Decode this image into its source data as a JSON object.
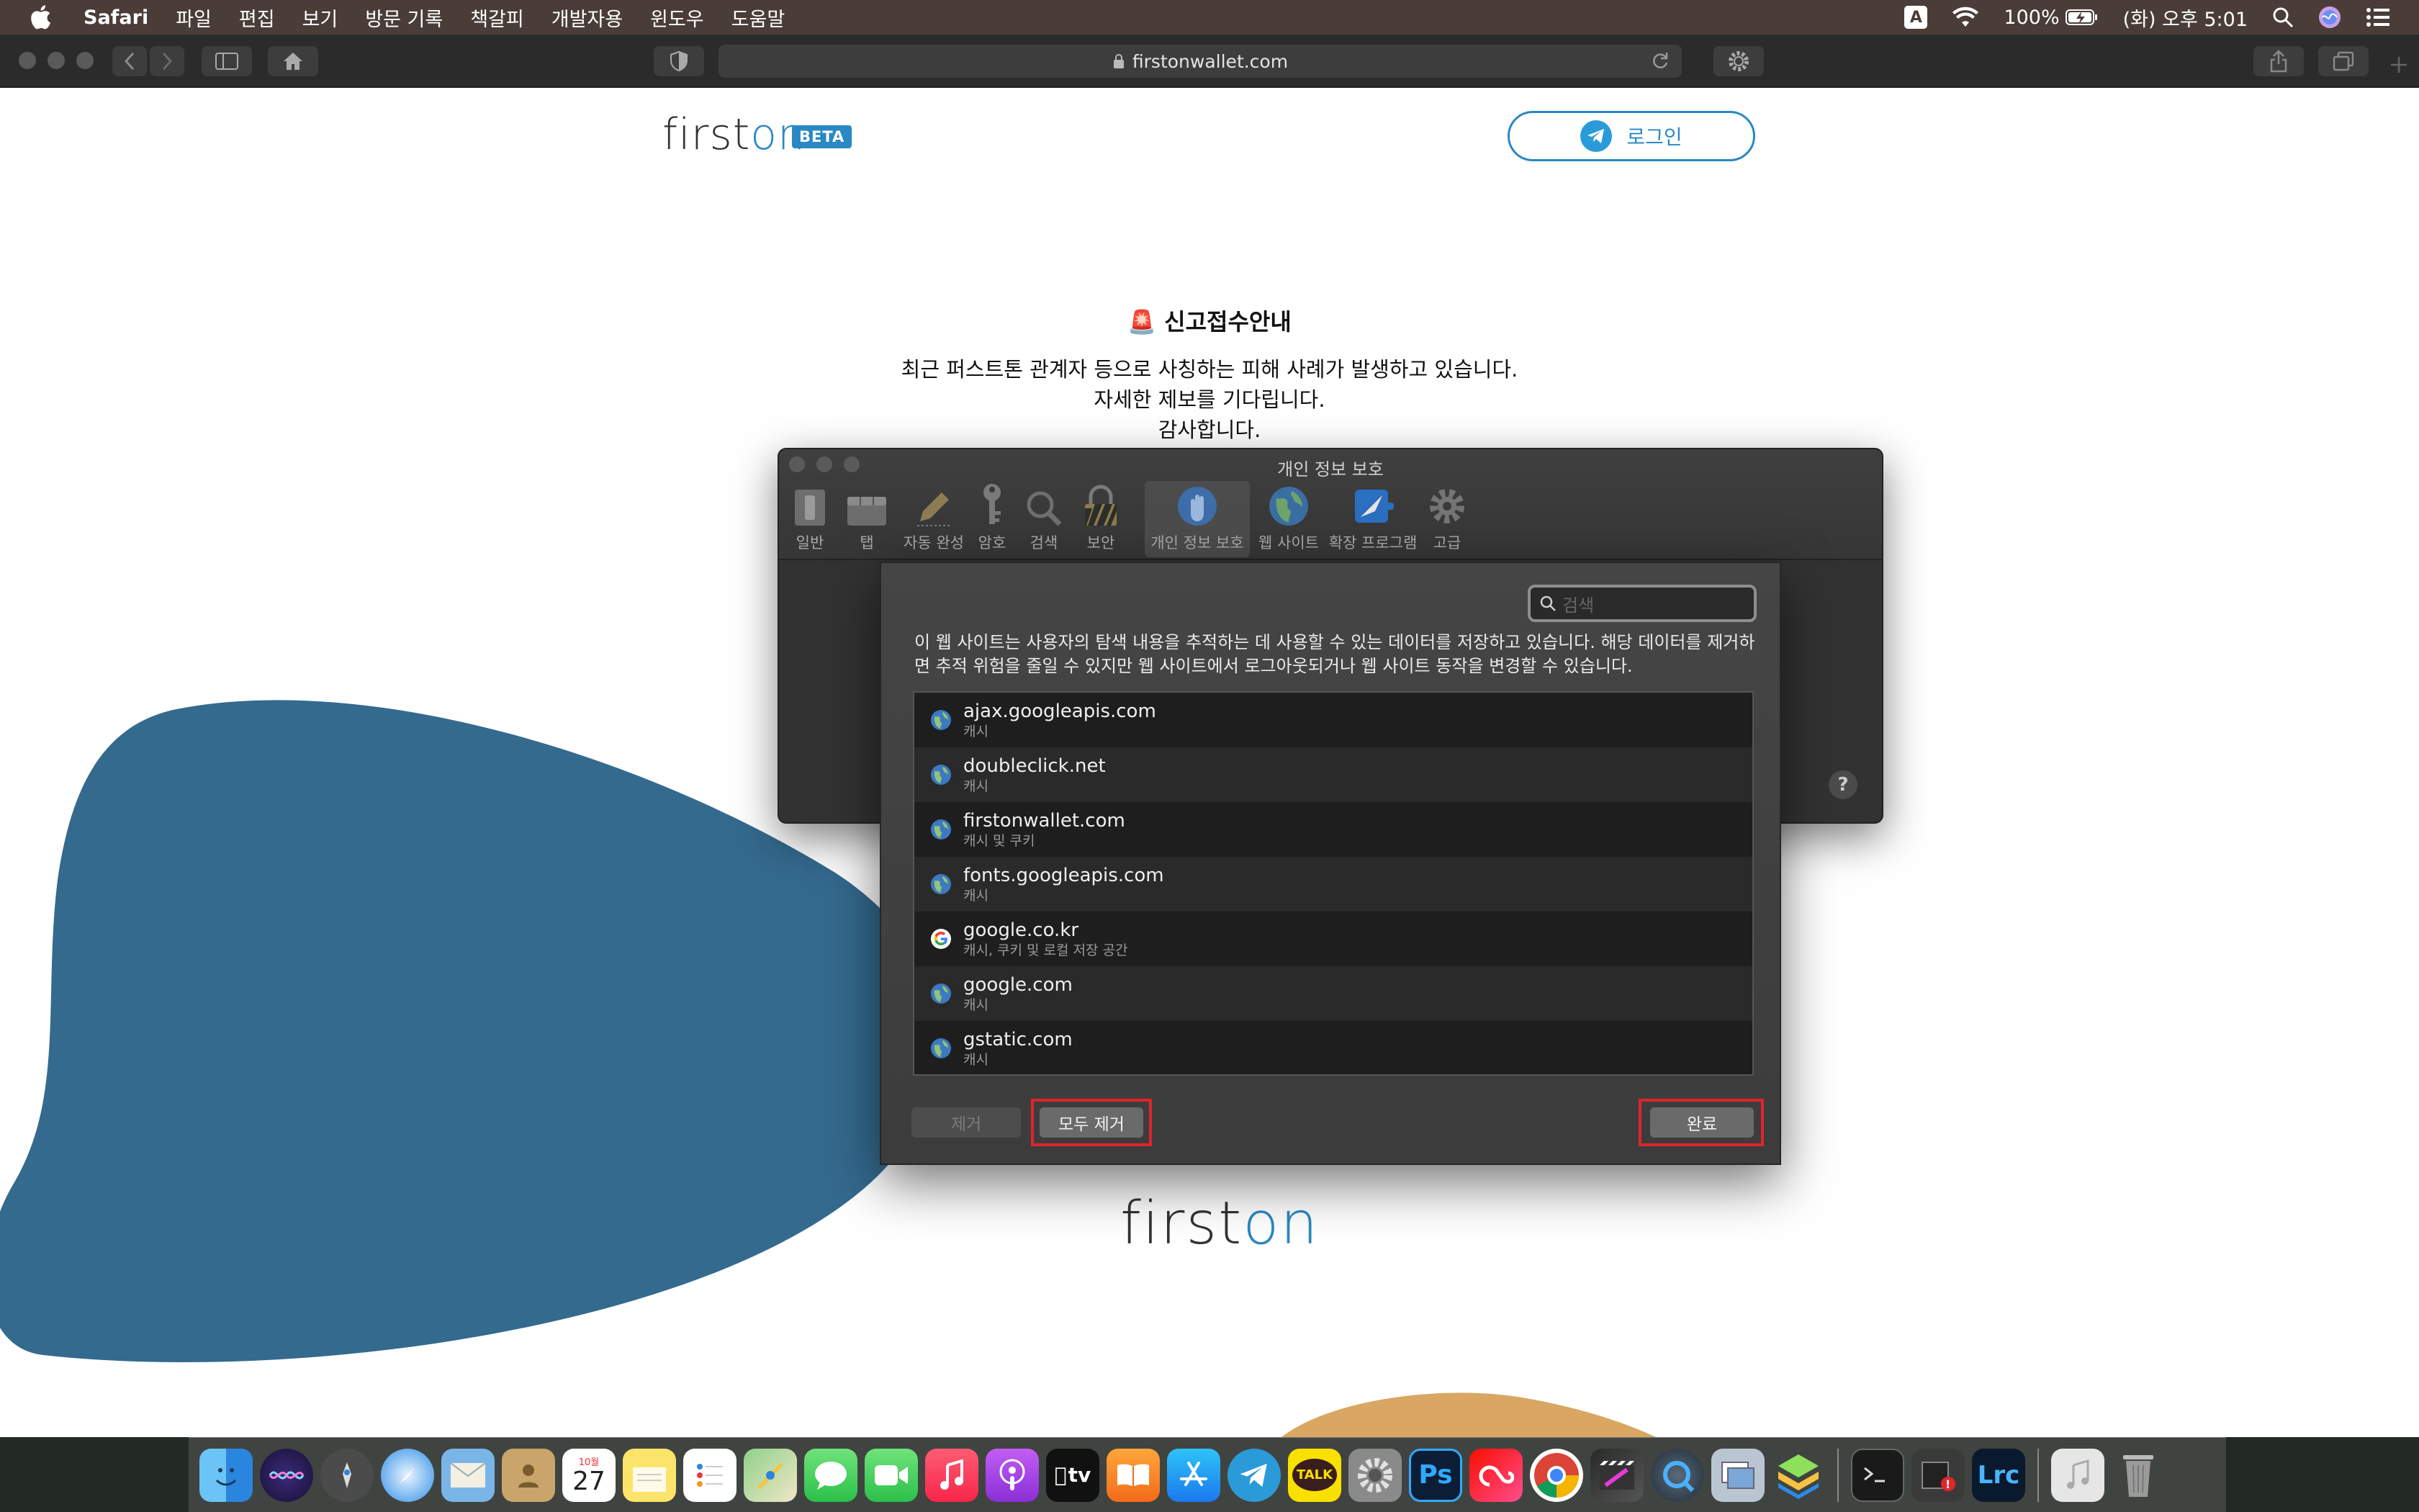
{
  "menubar": {
    "app": "Safari",
    "items": [
      "파일",
      "편집",
      "보기",
      "방문 기록",
      "책갈피",
      "개발자용",
      "윈도우",
      "도움말"
    ],
    "input_source": "A",
    "battery": "100%",
    "clock": "(화) 오후 5:01"
  },
  "toolbar": {
    "url": "firstonwallet.com"
  },
  "page": {
    "logo_first": "first",
    "logo_on": "on",
    "beta": "BETA",
    "login": "로그인",
    "notice_title": "🚨 신고접수안내",
    "notice_lines": [
      "최근 퍼스트톤 관계자 등으로 사칭하는 피해 사례가 발생하고 있습니다.",
      "자세한 제보를 기다립니다.",
      "감사합니다."
    ],
    "footer_first": "first",
    "footer_on": "on"
  },
  "prefs": {
    "title": "개인 정보 보호",
    "tabs": [
      "일반",
      "탭",
      "자동 완성",
      "암호",
      "검색",
      "보안",
      "개인 정보 보호",
      "웹 사이트",
      "확장 프로그램",
      "고급"
    ],
    "active_tab": "개인 정보 보호",
    "help": "?"
  },
  "sheet": {
    "search_placeholder": "검색",
    "description": "이 웹 사이트는 사용자의 탐색 내용을 추적하는 데 사용할 수 있는 데이터를 저장하고 있습니다. 해당 데이터를 제거하면 추적 위험을 줄일 수 있지만 웹 사이트에서 로그아웃되거나 웹 사이트 동작을 변경할 수 있습니다.",
    "sites": [
      {
        "domain": "ajax.googleapis.com",
        "data": "캐시",
        "icon": "globe-icon"
      },
      {
        "domain": "doubleclick.net",
        "data": "캐시",
        "icon": "globe-icon"
      },
      {
        "domain": "firstonwallet.com",
        "data": "캐시 및 쿠키",
        "icon": "globe-icon"
      },
      {
        "domain": "fonts.googleapis.com",
        "data": "캐시",
        "icon": "globe-icon"
      },
      {
        "domain": "google.co.kr",
        "data": "캐시, 쿠키 및 로컬 저장 공간",
        "icon": "google-icon"
      },
      {
        "domain": "google.com",
        "data": "캐시",
        "icon": "globe-icon"
      },
      {
        "domain": "gstatic.com",
        "data": "캐시",
        "icon": "globe-icon"
      }
    ],
    "remove": "제거",
    "remove_all": "모두 제거",
    "done": "완료"
  },
  "dock": {
    "apps": [
      "finder-icon",
      "siri-icon",
      "launchpad-icon",
      "safari-icon",
      "mail-icon",
      "contacts-icon",
      "calendar-icon",
      "notes-icon",
      "reminders-icon",
      "maps-icon",
      "messages-icon",
      "facetime-icon",
      "music-icon",
      "podcasts-icon",
      "tv-icon",
      "books-icon",
      "appstore-icon",
      "telegram-icon",
      "kakaotalk-icon",
      "system-preferences-icon",
      "photoshop-icon",
      "creative-cloud-icon",
      "chrome-icon",
      "final-cut-icon",
      "quicktime-icon",
      "preview-icon",
      "bluestacks-icon",
      "terminal-icon",
      "activity-icon",
      "lightroom-icon",
      "music-file-icon",
      "trash-icon"
    ],
    "calendar_month": "10월",
    "calendar_day": "27",
    "kakao_label": "TALK",
    "ps_label": "Ps",
    "lrc_label": "Lrc",
    "tv_label": "tv"
  }
}
